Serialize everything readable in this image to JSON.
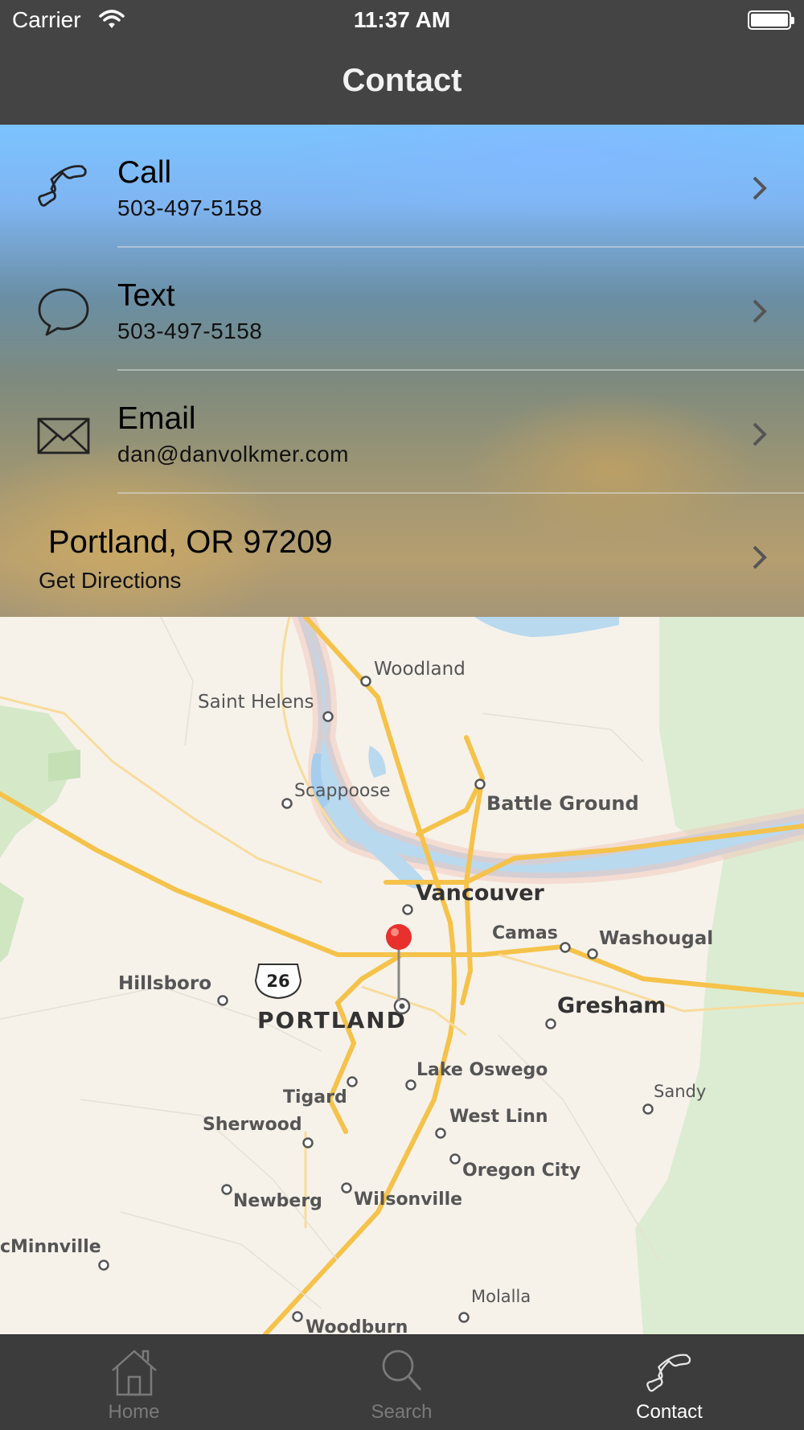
{
  "status_bar": {
    "carrier": "Carrier",
    "time": "11:37 AM",
    "battery_level": 1.0
  },
  "nav": {
    "title": "Contact"
  },
  "contact_rows": [
    {
      "icon": "phone-icon",
      "title": "Call",
      "subtitle": "503-497-5158"
    },
    {
      "icon": "chat-bubble-icon",
      "title": "Text",
      "subtitle": "503-497-5158"
    },
    {
      "icon": "envelope-icon",
      "title": "Email",
      "subtitle": "dan@danvolkmer.com"
    }
  ],
  "address": {
    "title": "Portland, OR 97209",
    "subtitle": "Get Directions"
  },
  "map": {
    "labels": {
      "woodland": "Woodland",
      "saint_helens": "Saint Helens",
      "scappoose": "Scappoose",
      "battle_ground": "Battle Ground",
      "vancouver": "Vancouver",
      "camas": "Camas",
      "washougal": "Washougal",
      "hillsboro": "Hillsboro",
      "portland": "PORTLAND",
      "gresham": "Gresham",
      "lake_oswego": "Lake Oswego",
      "tigard": "Tigard",
      "sherwood": "Sherwood",
      "west_linn": "West Linn",
      "oregon_city": "Oregon City",
      "sandy": "Sandy",
      "newberg": "Newberg",
      "wilsonville": "Wilsonville",
      "mcminnville": "cMinnville",
      "molalla": "Molalla",
      "woodburn": "Woodburn",
      "highway_shield": "26"
    },
    "colors": {
      "land": "#f6f2ea",
      "water": "#a6cdec",
      "forest": "#d9ebcf",
      "road": "#f5c24a",
      "pin": "#e8302c"
    }
  },
  "tabs": [
    {
      "icon": "home-icon",
      "label": "Home",
      "active": false
    },
    {
      "icon": "search-icon",
      "label": "Search",
      "active": false
    },
    {
      "icon": "phone-icon",
      "label": "Contact",
      "active": true
    }
  ]
}
